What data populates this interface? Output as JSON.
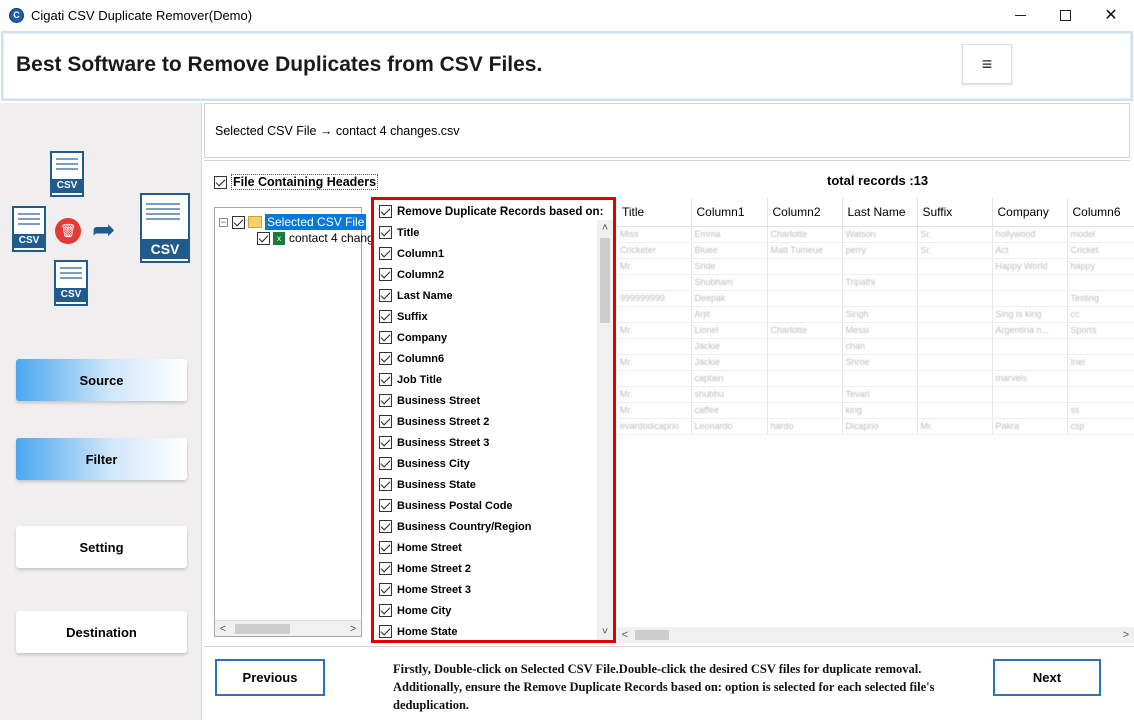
{
  "window": {
    "title": "Cigati CSV Duplicate Remover(Demo)",
    "icon_letter": "C",
    "controls": {
      "minimize": "minimize-icon",
      "maximize": "maximize-icon",
      "close": "✕"
    }
  },
  "banner": {
    "title": "Best Software to Remove Duplicates from CSV Files.",
    "menu_icon": "≡"
  },
  "sidebar": {
    "illustration": {
      "doc_label": "CSV",
      "delete_icon": "🗑",
      "arrow_icon": "➦"
    },
    "nav": [
      {
        "label": "Source",
        "active": true
      },
      {
        "label": "Filter",
        "active": true
      },
      {
        "label": "Setting",
        "active": false
      },
      {
        "label": "Destination",
        "active": false
      }
    ]
  },
  "main": {
    "selected_file": "Selected CSV File → contact 4 changes.csv",
    "headers_checkbox_label": "File Containing Headers",
    "total_records": "total records :13",
    "tree": {
      "root_expander": "−",
      "root_label": "Selected CSV File",
      "child_label": "contact 4 chang",
      "xls_icon": "x",
      "scroll_left": "<",
      "scroll_right": ">"
    },
    "columns_header": "Remove Duplicate Records based on:",
    "columns": [
      "Title",
      "Column1",
      "Column2",
      "Last Name",
      "Suffix",
      "Company",
      "Column6",
      "Job Title",
      "Business Street",
      "Business Street 2",
      "Business Street 3",
      "Business City",
      "Business State",
      "Business Postal Code",
      "Business Country/Region",
      "Home Street",
      "Home Street 2",
      "Home Street 3",
      "Home City",
      "Home State"
    ],
    "columns_scroll": {
      "up": "˄",
      "down": "˅"
    },
    "preview": {
      "headers": [
        "Title",
        "Column1",
        "Column2",
        "Last Name",
        "Suffix",
        "Company",
        "Column6"
      ],
      "rows": [
        [
          "Miss",
          "Emma",
          "Charlotte",
          "Watson",
          "Sr.",
          "hollywood",
          "model"
        ],
        [
          "Cricketer",
          "Bluee",
          "Matt Tumeue",
          "perry",
          "Sr.",
          "Act",
          "Cricket"
        ],
        [
          "Mr.",
          "Sride",
          "",
          "",
          "",
          "Happy World",
          "happy"
        ],
        [
          "",
          "Shubham",
          "",
          "Tripathi",
          "",
          "",
          ""
        ],
        [
          "999999999",
          "Deepak",
          "",
          "",
          "",
          "",
          "Testing"
        ],
        [
          "",
          "Arjit",
          "",
          "Singh",
          "",
          "Sing is king",
          "cc"
        ],
        [
          "Mr.",
          "Lionel",
          "Charlotte",
          "Messi",
          "",
          "Argentina n...",
          "Sports"
        ],
        [
          "",
          "Jackie",
          "",
          "chan",
          "",
          "",
          ""
        ],
        [
          "Mr.",
          "Jackie",
          "",
          "Shroe",
          "",
          "",
          "Inel"
        ],
        [
          "",
          "captain",
          "",
          "",
          "",
          "marvels",
          ""
        ],
        [
          "Mr.",
          "shubhu",
          "",
          "Tevari",
          "",
          "",
          ""
        ],
        [
          "Mr.",
          "caffee",
          "",
          "king",
          "",
          "",
          "ss"
        ],
        [
          "evardodicaprio",
          "Leonardo",
          "hardo",
          "Dicaprio",
          "Mr.",
          "Pakra",
          "csp"
        ]
      ],
      "scroll_left": "<",
      "scroll_right": ">"
    },
    "buttons": {
      "previous": "Previous",
      "next": "Next"
    },
    "instructions": "Firstly, Double-click on Selected CSV File.Double-click the desired CSV files for duplicate removal. Additionally, ensure the Remove Duplicate Records based on: option is selected for each selected file's deduplication."
  }
}
